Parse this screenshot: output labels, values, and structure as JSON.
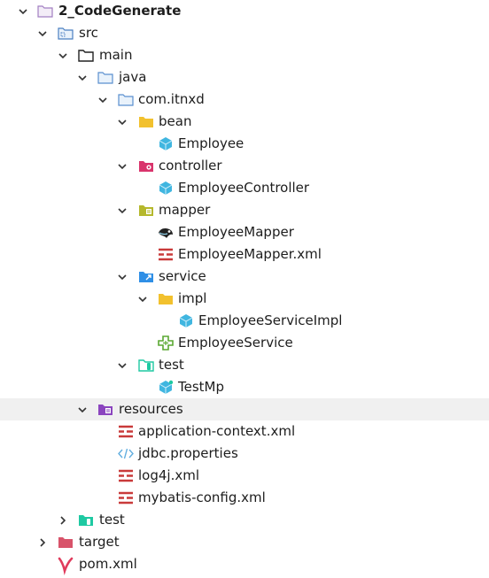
{
  "tree": {
    "project": {
      "label": "2_CodeGenerate",
      "icon": "folder-outline-icon",
      "state": "expanded"
    },
    "src": {
      "label": "src",
      "icon": "source-folder-icon",
      "state": "expanded"
    },
    "main": {
      "label": "main",
      "icon": "folder-icon",
      "state": "expanded"
    },
    "java": {
      "label": "java",
      "icon": "source-root-folder-icon",
      "state": "expanded"
    },
    "package": {
      "label": "com.itnxd",
      "icon": "package-folder-icon",
      "state": "expanded"
    },
    "bean": {
      "label": "bean",
      "icon": "yellow-folder-icon",
      "state": "expanded"
    },
    "employee": {
      "label": "Employee",
      "icon": "java-class-icon"
    },
    "controller": {
      "label": "controller",
      "icon": "controller-folder-icon",
      "state": "expanded"
    },
    "employee_controller": {
      "label": "EmployeeController",
      "icon": "java-class-icon"
    },
    "mapper": {
      "label": "mapper",
      "icon": "mapper-folder-icon",
      "state": "expanded"
    },
    "employee_mapper": {
      "label": "EmployeeMapper",
      "icon": "mybatis-mapper-icon"
    },
    "employee_mapper_xml": {
      "label": "EmployeeMapper.xml",
      "icon": "xml-file-icon"
    },
    "service": {
      "label": "service",
      "icon": "service-folder-icon",
      "state": "expanded"
    },
    "impl": {
      "label": "impl",
      "icon": "yellow-folder-icon",
      "state": "expanded"
    },
    "employee_service_impl": {
      "label": "EmployeeServiceImpl",
      "icon": "java-class-icon"
    },
    "employee_service": {
      "label": "EmployeeService",
      "icon": "java-interface-icon"
    },
    "test_pkg": {
      "label": "test",
      "icon": "test-package-folder-icon",
      "state": "expanded"
    },
    "test_mp": {
      "label": "TestMp",
      "icon": "java-test-class-icon"
    },
    "resources": {
      "label": "resources",
      "icon": "resources-folder-icon",
      "state": "expanded"
    },
    "application_context": {
      "label": "application-context.xml",
      "icon": "xml-file-icon"
    },
    "jdbc_properties": {
      "label": "jdbc.properties",
      "icon": "properties-file-icon"
    },
    "log4j": {
      "label": "log4j.xml",
      "icon": "xml-file-icon"
    },
    "mybatis_config": {
      "label": "mybatis-config.xml",
      "icon": "xml-file-icon"
    },
    "test_dir": {
      "label": "test",
      "icon": "test-root-folder-icon",
      "state": "collapsed"
    },
    "target": {
      "label": "target",
      "icon": "excluded-folder-icon",
      "state": "collapsed"
    },
    "pom": {
      "label": "pom.xml",
      "icon": "maven-icon"
    }
  },
  "colors": {
    "selected_row_bg": "#f0f0f0",
    "java_class": "#40b6e0",
    "xml_file": "#c93a3a",
    "bean_folder": "#f2c12e",
    "controller_folder": "#d9346c",
    "mapper_folder": "#b5b82c",
    "service_folder": "#2f8fe6",
    "test_folder": "#1ec9a2",
    "resources_folder": "#8b45bf",
    "excluded_folder": "#d8536a",
    "maven": "#e03b5c"
  }
}
